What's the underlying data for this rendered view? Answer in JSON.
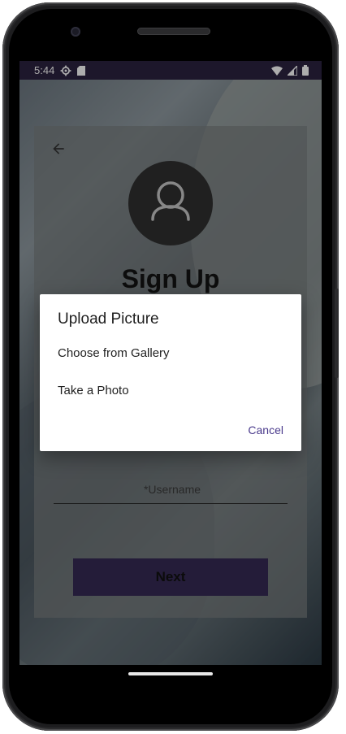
{
  "status_bar": {
    "time": "5:44",
    "icons": [
      "settings-gear-icon",
      "sd-card-icon",
      "wifi-icon",
      "signal-icon",
      "battery-icon"
    ]
  },
  "signup": {
    "title": "Sign Up",
    "username_placeholder": "*Username",
    "next_label": "Next"
  },
  "dialog": {
    "title": "Upload Picture",
    "options": [
      "Choose from Gallery",
      "Take a Photo"
    ],
    "cancel_label": "Cancel"
  },
  "colors": {
    "status_bar_bg": "#2b2240",
    "accent": "#4a3a8c",
    "next_button_bg": "#352a55"
  }
}
